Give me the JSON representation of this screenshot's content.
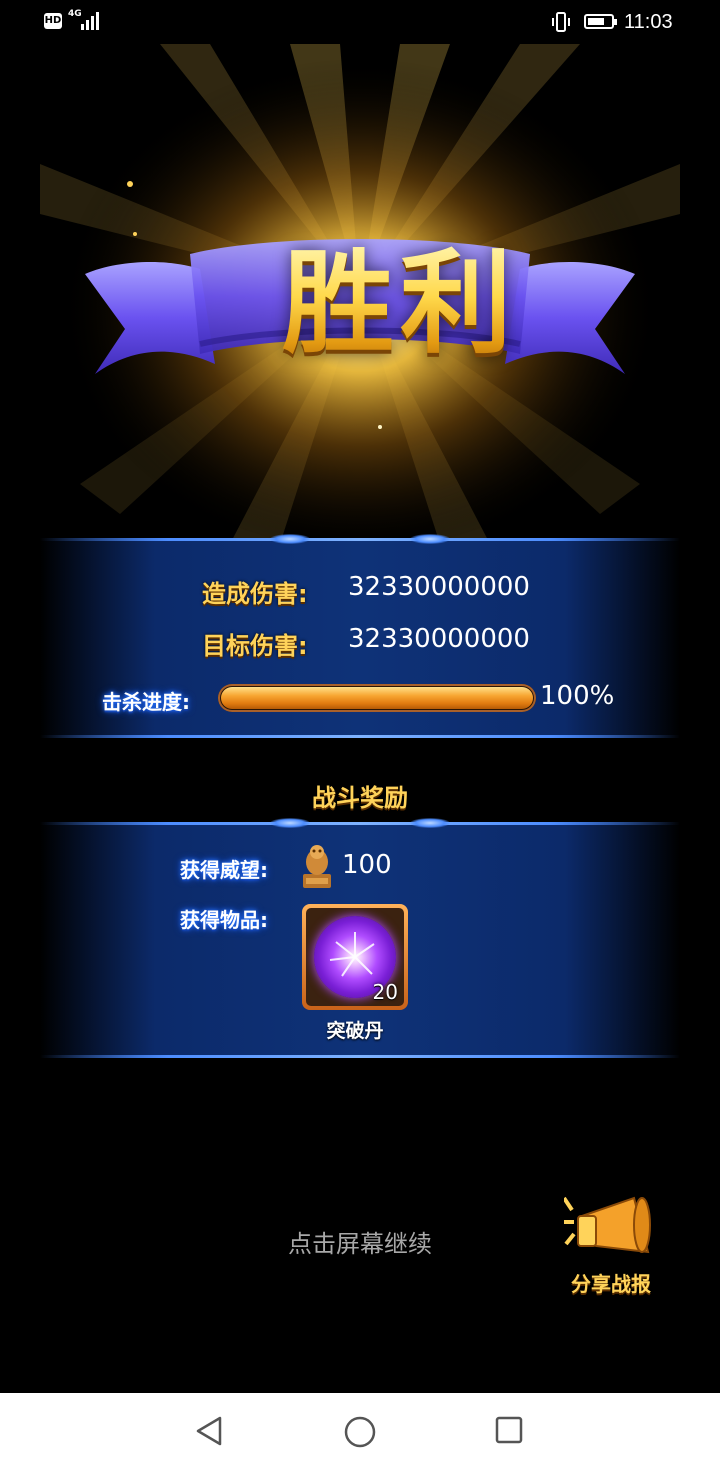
{
  "status_bar": {
    "hd": "HD",
    "network": "4G",
    "time": "11:03",
    "battery_level": 0.8
  },
  "banner": {
    "title": "胜利"
  },
  "stats": {
    "damage_dealt_label": "造成伤害:",
    "damage_dealt_value": "32330000000",
    "target_damage_label": "目标伤害:",
    "target_damage_value": "32330000000",
    "kill_progress_label": "击杀进度:",
    "kill_progress_percent": 100,
    "kill_progress_text": "100%"
  },
  "rewards": {
    "title": "战斗奖励",
    "prestige_label": "获得威望:",
    "prestige_value": "100",
    "items_label": "获得物品:",
    "items": [
      {
        "name": "突破丹",
        "count": "20",
        "icon": "purple-orb-icon"
      }
    ]
  },
  "continue_hint": "点击屏幕继续",
  "share": {
    "label": "分享战报",
    "icon": "megaphone-icon"
  },
  "nav_bar": {
    "back_icon": "triangle-back-icon",
    "home_icon": "circle-home-icon",
    "recents_icon": "square-recents-icon"
  },
  "colors": {
    "gold": "#ffd35a",
    "panel_blue": "#0e3278",
    "progress_orange": "#f7a531"
  }
}
